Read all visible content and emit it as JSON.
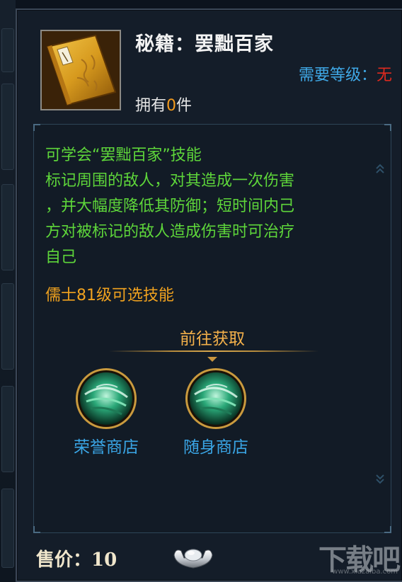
{
  "item": {
    "title": "秘籍：罢黜百家",
    "required_level_label": "需要等级：",
    "required_level_value": "无",
    "own_prefix": "拥有",
    "own_count": "0",
    "own_suffix": "件",
    "icon": "skill-book-icon"
  },
  "description": {
    "lines": [
      "可学会“罢黜百家”技能",
      "标记周围的敌人，对其造成一次伤害",
      "，并大幅度降低其防御；短时间内己",
      "方对被标记的敌人造成伤害时可治疗",
      "自己"
    ],
    "class_note": "儒士81级可选技能"
  },
  "obtain": {
    "title": "前往获取",
    "shops": [
      {
        "label": "荣誉商店",
        "icon": "jade-orb-icon"
      },
      {
        "label": "随身商店",
        "icon": "jade-orb-icon"
      }
    ]
  },
  "sell": {
    "price_label": "售价：",
    "price_value": "10",
    "currency_icon": "silver-ingot-icon"
  },
  "watermark": {
    "logo_text": "下载吧",
    "url": "www.xiazaiba.com"
  },
  "colors": {
    "description_green": "#5ed63a",
    "class_note_orange": "#f0a21f",
    "link_blue": "#3aa6e6",
    "required_red": "#e02a1e",
    "count_orange": "#f39a1c"
  }
}
